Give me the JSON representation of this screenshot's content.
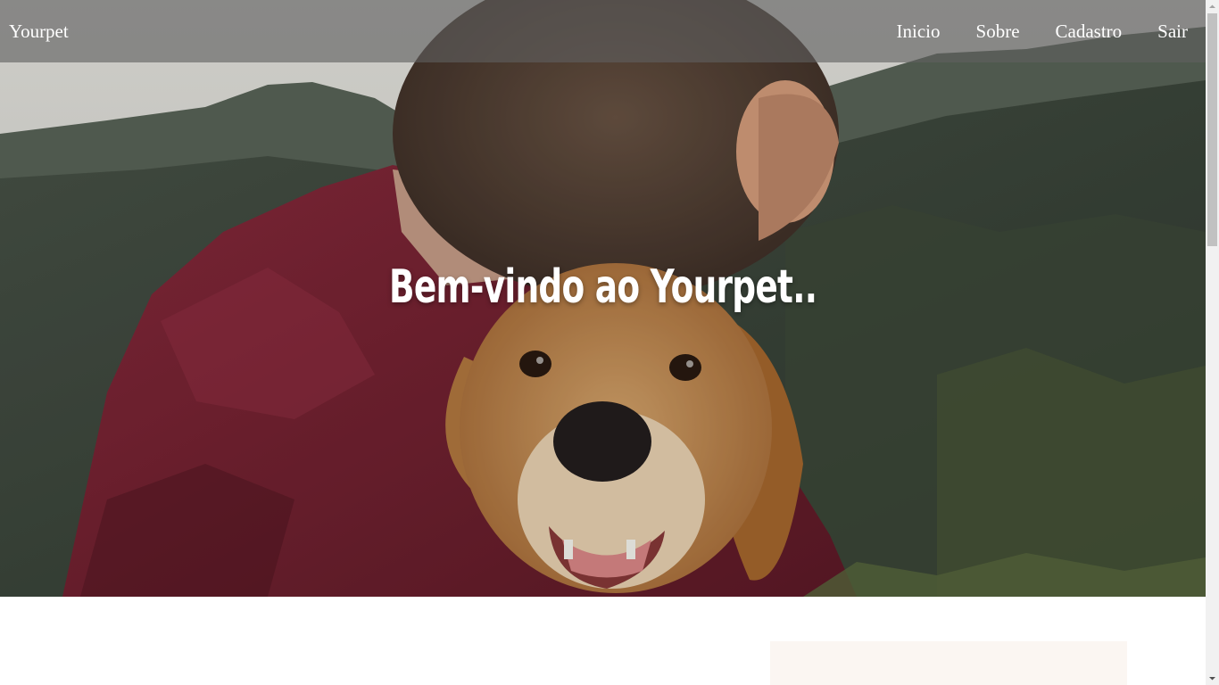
{
  "navbar": {
    "brand": "Yourpet",
    "links": [
      {
        "label": "Inicio"
      },
      {
        "label": "Sobre"
      },
      {
        "label": "Cadastro"
      },
      {
        "label": "Sair"
      }
    ]
  },
  "hero": {
    "title": "Bem-vindo ao Yourpet..",
    "image": "man-hugging-golden-retriever-photo"
  },
  "colors": {
    "navbar_bg": "#5f5f5f",
    "shirt": "#7b2233",
    "dog_fur": "#c08a4f",
    "card_bg": "#fbf6f2"
  },
  "scrollbar": {
    "icons": [
      "triangle-up-icon",
      "triangle-down-icon"
    ]
  }
}
